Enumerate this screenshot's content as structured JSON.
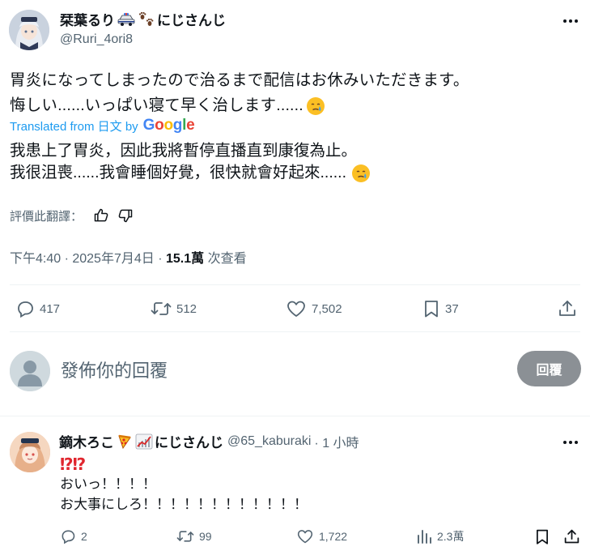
{
  "tweet": {
    "display_name": "栞葉るり",
    "name_suffix": "にじさんじ",
    "handle": "@Ruri_4ori8",
    "text_line1": "胃炎になってしまったので治るまで配信はお休みいただきます。",
    "text_line2": "悔しい......いっぱい寝て早く治します......",
    "translated_from": "Translated from 日文 by",
    "translator": "Google",
    "translation_line1": "我患上了胃炎，因此我將暫停直播直到康復為止。",
    "translation_line2": "我很沮喪......我會睡個好覺，很快就會好起來......",
    "rate_label": "評價此翻譯：",
    "time": "下午4:40 · 2025年7月4日 · ",
    "views_count": "15.1萬",
    "views_label": " 次查看",
    "stats": {
      "replies": "417",
      "retweets": "512",
      "likes": "7,502",
      "bookmarks": "37"
    }
  },
  "composer": {
    "placeholder": "發佈你的回覆",
    "button": "回覆"
  },
  "reply": {
    "display_name": "鏑木ろこ",
    "name_suffix": "にじさんじ",
    "handle": "@65_kaburaki",
    "time": "· 1 小時",
    "marks": "⁉⁉",
    "line1": "おいっ！！！！",
    "line2": "お大事にしろ！！！！！！！！！！！！",
    "stats": {
      "replies": "2",
      "retweets": "99",
      "likes": "1,722",
      "views": "2.3萬"
    }
  },
  "colors": {
    "accent": "#1d9bf0",
    "secondary_text": "#536471",
    "reply_button": "#8b9095",
    "marks": "#e0262e"
  }
}
